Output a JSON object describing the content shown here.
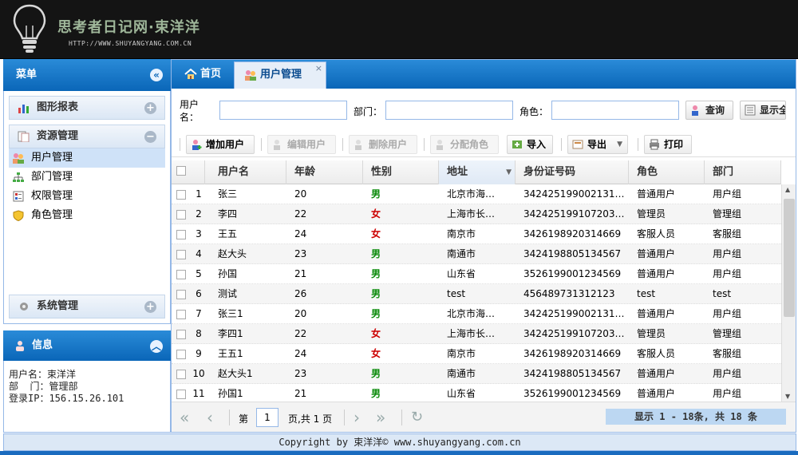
{
  "header": {
    "title": "思考者日记网·束洋洋",
    "url": "HTTP://WWW.SHUYANGYANG.COM.CN"
  },
  "menu": {
    "title": "菜单",
    "groups": [
      {
        "label": "图形报表",
        "toggle": "+"
      },
      {
        "label": "资源管理",
        "toggle": "−"
      },
      {
        "label": "系统管理",
        "toggle": "+"
      }
    ],
    "items": [
      "用户管理",
      "部门管理",
      "权限管理",
      "角色管理"
    ]
  },
  "info": {
    "title": "信息",
    "lines": [
      "用户名：束洋洋",
      "部  门：管理部",
      "登录IP：156.15.26.101"
    ]
  },
  "tabs": {
    "home": "首页",
    "active": "用户管理",
    "close": "×"
  },
  "search": {
    "username_label": "用户名：",
    "dept_label": "部门：",
    "role_label": "角色：",
    "query_button": "查询",
    "show_all_button": "显示全部"
  },
  "toolbar": {
    "add": "增加用户",
    "edit": "编辑用户",
    "delete": "删除用户",
    "assign": "分配角色",
    "import": "导入",
    "export": "导出",
    "print": "打印"
  },
  "columns": [
    "用户名",
    "年龄",
    "性别",
    "地址",
    "身份证号码",
    "角色",
    "部门"
  ],
  "rows": [
    {
      "n": "1",
      "name": "张三",
      "age": "20",
      "sex": "男",
      "addr": "北京市海…",
      "id": "342425199002131…",
      "role": "普通用户",
      "dept": "用户组"
    },
    {
      "n": "2",
      "name": "李四",
      "age": "22",
      "sex": "女",
      "addr": "上海市长…",
      "id": "342425199107203…",
      "role": "管理员",
      "dept": "管理组"
    },
    {
      "n": "3",
      "name": "王五",
      "age": "24",
      "sex": "女",
      "addr": "南京市",
      "id": "3426198920314669",
      "role": "客服人员",
      "dept": "客服组"
    },
    {
      "n": "4",
      "name": "赵大头",
      "age": "23",
      "sex": "男",
      "addr": "南通市",
      "id": "3424198805134567",
      "role": "普通用户",
      "dept": "用户组"
    },
    {
      "n": "5",
      "name": "孙国",
      "age": "21",
      "sex": "男",
      "addr": "山东省",
      "id": "3526199001234569",
      "role": "普通用户",
      "dept": "用户组"
    },
    {
      "n": "6",
      "name": "测试",
      "age": "26",
      "sex": "男",
      "addr": "test",
      "id": "456489731312123",
      "role": "test",
      "dept": "test"
    },
    {
      "n": "7",
      "name": "张三1",
      "age": "20",
      "sex": "男",
      "addr": "北京市海…",
      "id": "342425199002131…",
      "role": "普通用户",
      "dept": "用户组"
    },
    {
      "n": "8",
      "name": "李四1",
      "age": "22",
      "sex": "女",
      "addr": "上海市长…",
      "id": "342425199107203…",
      "role": "管理员",
      "dept": "管理组"
    },
    {
      "n": "9",
      "name": "王五1",
      "age": "24",
      "sex": "女",
      "addr": "南京市",
      "id": "3426198920314669",
      "role": "客服人员",
      "dept": "客服组"
    },
    {
      "n": "10",
      "name": "赵大头1",
      "age": "23",
      "sex": "男",
      "addr": "南通市",
      "id": "3424198805134567",
      "role": "普通用户",
      "dept": "用户组"
    },
    {
      "n": "11",
      "name": "孙国1",
      "age": "21",
      "sex": "男",
      "addr": "山东省",
      "id": "3526199001234569",
      "role": "普通用户",
      "dept": "用户组"
    }
  ],
  "pager": {
    "page_prefix": "第",
    "page_value": "1",
    "page_suffix": "页,共 1 页",
    "info": "显示 1 - 18条, 共 18 条"
  },
  "footer": {
    "text": "Copyright by 束洋洋© www.shuyangyang.com.cn"
  },
  "colors": {
    "accent": "#0a66b8",
    "male": "#0a8a0a",
    "female": "#cc0000"
  }
}
